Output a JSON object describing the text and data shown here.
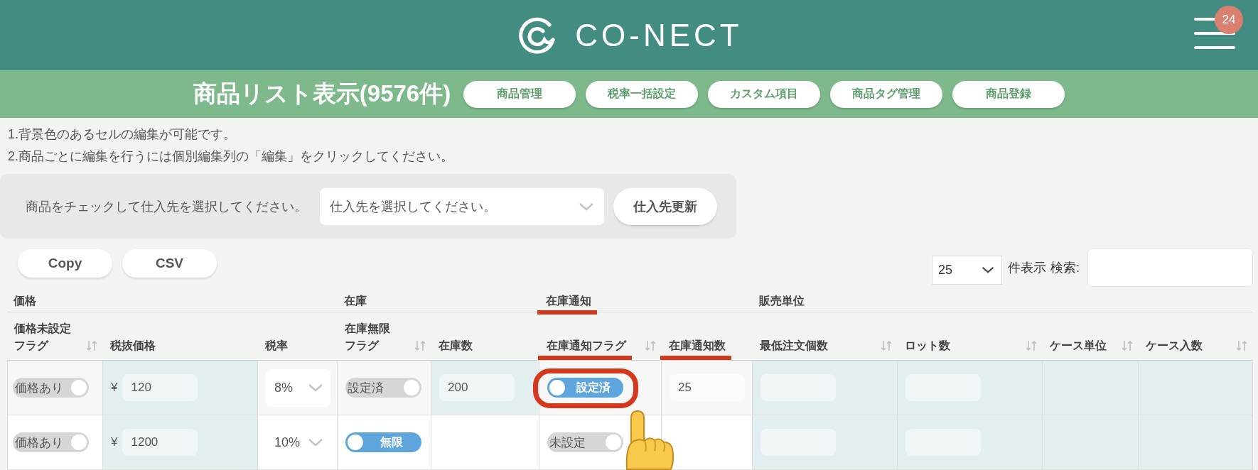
{
  "header": {
    "logo_text": "CO-NECT",
    "notification_count": "24"
  },
  "title_bar": {
    "title": "商品リスト表示(9576件)",
    "buttons": [
      "商品管理",
      "税率一括設定",
      "カスタム項目",
      "商品タグ管理",
      "商品登録"
    ]
  },
  "notes": [
    "1.背景色のあるセルの編集が可能です。",
    "2.商品ごとに編集を行うには個別編集列の「編集」をクリックしてください。"
  ],
  "supplier_bar": {
    "label": "商品をチェックして仕入先を選択してください。",
    "select": {
      "placeholder": "仕入先を選択してください。"
    },
    "button": "仕入先更新"
  },
  "export_buttons": [
    "Copy",
    "CSV"
  ],
  "table_controls": {
    "page_size": "25",
    "page_size_label": "件表示",
    "search_label": "検索:"
  },
  "table": {
    "groups": [
      {
        "label": "価格",
        "marked": false,
        "columns": [
          {
            "lines": [
              "価格未設定",
              "フラグ"
            ],
            "sortable": true,
            "marked": false
          },
          {
            "lines": [
              "税抜価格"
            ],
            "sortable": false,
            "marked": false
          },
          {
            "lines": [
              "税率"
            ],
            "sortable": false,
            "marked": false
          }
        ]
      },
      {
        "label": "在庫",
        "marked": false,
        "columns": [
          {
            "lines": [
              "在庫無限",
              "フラグ"
            ],
            "sortable": true,
            "marked": false
          },
          {
            "lines": [
              "在庫数"
            ],
            "sortable": false,
            "marked": false
          }
        ]
      },
      {
        "label": "在庫通知",
        "marked": true,
        "columns": [
          {
            "lines": [
              "在庫通知フラグ"
            ],
            "sortable": true,
            "marked": true
          },
          {
            "lines": [
              "在庫通知数"
            ],
            "sortable": false,
            "marked": true
          }
        ]
      },
      {
        "label": "販売単位",
        "marked": false,
        "columns": [
          {
            "lines": [
              "最低注文個数"
            ],
            "sortable": true,
            "marked": false
          },
          {
            "lines": [
              "ロット数"
            ],
            "sortable": true,
            "marked": false
          },
          {
            "lines": [
              "ケース単位"
            ],
            "sortable": true,
            "marked": false
          },
          {
            "lines": [
              "ケース入数"
            ],
            "sortable": true,
            "marked": false
          }
        ]
      }
    ],
    "rows": [
      {
        "cells": [
          {
            "kind": "toggle",
            "label": "価格あり",
            "on": false,
            "editable": false,
            "highlighted": false
          },
          {
            "kind": "price",
            "currency": "¥",
            "value": "120",
            "editable": true,
            "highlighted": false
          },
          {
            "kind": "select",
            "value": "8%",
            "editable": false,
            "highlighted": false
          },
          {
            "kind": "toggle",
            "label": "設定済",
            "on": false,
            "editable": false,
            "highlighted": false
          },
          {
            "kind": "input",
            "value": "200",
            "editable": true,
            "highlighted": false
          },
          {
            "kind": "toggle",
            "label": "設定済",
            "on": true,
            "editable": false,
            "highlighted": true
          },
          {
            "kind": "input",
            "value": "25",
            "editable": false,
            "highlighted": false
          },
          {
            "kind": "input",
            "editable": true,
            "highlighted": false
          },
          {
            "kind": "input",
            "editable": true,
            "highlighted": false
          },
          {
            "kind": "blank",
            "editable": true,
            "highlighted": false
          },
          {
            "kind": "blank",
            "editable": true,
            "highlighted": false
          }
        ]
      },
      {
        "cells": [
          {
            "kind": "toggle",
            "label": "価格あり",
            "on": false,
            "editable": false,
            "highlighted": false
          },
          {
            "kind": "price",
            "currency": "¥",
            "value": "1200",
            "editable": true,
            "highlighted": false
          },
          {
            "kind": "select",
            "value": "10%",
            "editable": false,
            "highlighted": false
          },
          {
            "kind": "toggle",
            "label": "無限",
            "on": true,
            "editable": false,
            "highlighted": false
          },
          {
            "kind": "blank",
            "editable": false,
            "highlighted": false
          },
          {
            "kind": "toggle",
            "label": "未設定",
            "on": false,
            "editable": false,
            "highlighted": false
          },
          {
            "kind": "blank",
            "editable": false,
            "highlighted": false
          },
          {
            "kind": "input",
            "editable": true,
            "highlighted": false
          },
          {
            "kind": "input",
            "editable": true,
            "highlighted": false
          },
          {
            "kind": "blank",
            "editable": true,
            "highlighted": false
          },
          {
            "kind": "blank",
            "editable": true,
            "highlighted": false
          }
        ]
      }
    ]
  }
}
